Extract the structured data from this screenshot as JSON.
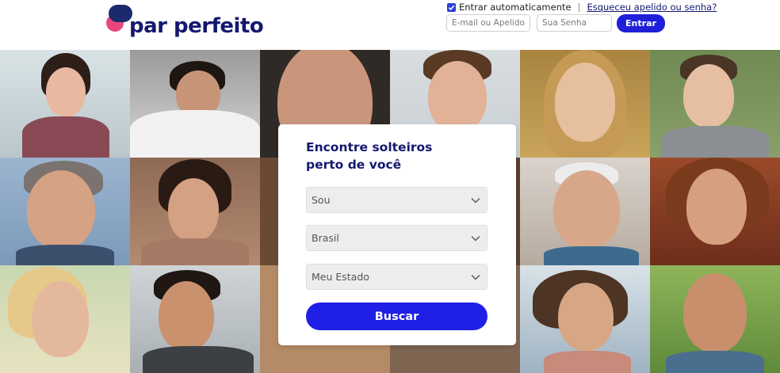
{
  "header": {
    "logo_text": "par perfeito",
    "auto_login_label": "Entrar automaticamente",
    "auto_login_checked": true,
    "separator": "|",
    "forgot_link": "Esqueceu apelido ou senha?",
    "email_placeholder": "E-mail ou Apelido",
    "password_placeholder": "Sua Senha",
    "login_button": "Entrar"
  },
  "search_card": {
    "title_line1": "Encontre solteiros",
    "title_line2": "perto de você",
    "gender_select": "Sou",
    "country_select": "Brasil",
    "state_select": "Meu Estado",
    "search_button": "Buscar"
  },
  "colors": {
    "brand_navy": "#14186e",
    "accent_blue": "#1f1fe6",
    "logo_pink": "#e8467c",
    "logo_navy": "#1a2a6c"
  },
  "icons": {
    "checkbox": "check-icon",
    "select_arrow": "chevron-down-icon"
  }
}
